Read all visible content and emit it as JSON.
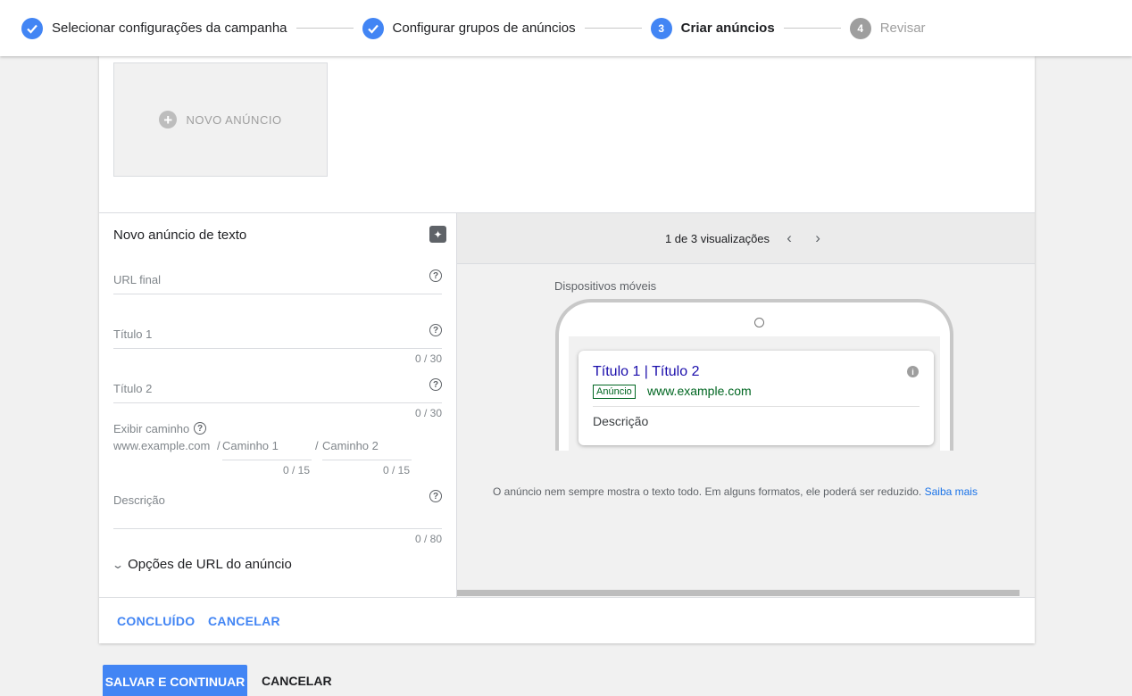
{
  "stepper": {
    "steps": [
      {
        "label": "Selecionar configurações da campanha",
        "state": "done",
        "marker": "✓"
      },
      {
        "label": "Configurar grupos de anúncios",
        "state": "done",
        "marker": "✓"
      },
      {
        "label": "Criar anúncios",
        "state": "active",
        "marker": "3"
      },
      {
        "label": "Revisar",
        "state": "pending",
        "marker": "4"
      }
    ]
  },
  "new_ad_tile": {
    "label": "NOVO ANÚNCIO",
    "icon": "plus-circle-icon"
  },
  "form": {
    "title": "Novo anúncio de texto",
    "final_url": {
      "label": "URL final",
      "value": ""
    },
    "title1": {
      "label": "Título 1",
      "counter": "0 / 30",
      "value": ""
    },
    "title2": {
      "label": "Título 2",
      "counter": "0 / 30",
      "value": ""
    },
    "display_path": {
      "label": "Exibir caminho",
      "domain": "www.example.com",
      "sep": "/",
      "path1": {
        "label": "Caminho 1",
        "counter": "0 / 15"
      },
      "path2": {
        "label": "Caminho 2",
        "counter": "0 / 15"
      }
    },
    "description": {
      "label": "Descrição",
      "counter": "0 / 80",
      "value": ""
    },
    "url_options": "Opções de URL do anúncio"
  },
  "preview": {
    "counter": "1 de 3 visualizações",
    "device": "Dispositivos móveis",
    "ad": {
      "title": "Título 1 | Título 2",
      "badge": "Anúncio",
      "url": "www.example.com",
      "description": "Descrição"
    },
    "note": "O anúncio nem sempre mostra o texto todo. Em alguns formatos, ele poderá ser reduzido.",
    "learn_more": "Saiba mais"
  },
  "card_actions": {
    "done": "CONCLUÍDO",
    "cancel": "CANCELAR"
  },
  "page_actions": {
    "save": "SALVAR E CONTINUAR",
    "cancel": "CANCELAR"
  },
  "colors": {
    "accent": "#4285f4",
    "link": "#1a0dab",
    "url_green": "#006621"
  }
}
